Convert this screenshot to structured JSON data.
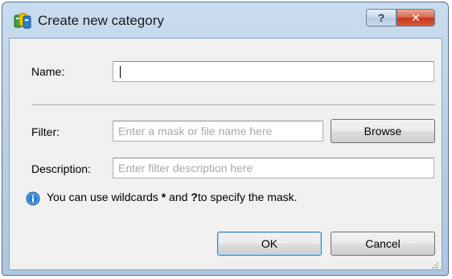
{
  "window": {
    "title": "Create new category",
    "help_label": "?",
    "close_label": "✕"
  },
  "form": {
    "name_label": "Name:",
    "name_value": "",
    "filter_label": "Filter:",
    "filter_placeholder": "Enter a mask or file name here",
    "browse_label": "Browse",
    "description_label": "Description:",
    "description_placeholder": "Enter filter description here"
  },
  "hint": {
    "text_before": "You can use wildcards",
    "wildcard_star": "*",
    "text_middle": "and",
    "wildcard_question": "?",
    "text_after": "to specify the mask."
  },
  "buttons": {
    "ok_label": "OK",
    "cancel_label": "Cancel"
  },
  "icons": {
    "app": "category-app-icon",
    "info": "info-icon",
    "help": "help-icon",
    "close": "close-icon",
    "grip": "resize-grip-icon"
  },
  "colors": {
    "title_bar": "#b7cde5",
    "close_button": "#c5371d",
    "dialog_background": "#f0f0f0",
    "info_icon": "#2f7fd0",
    "default_button_border": "#3c7fb1"
  }
}
